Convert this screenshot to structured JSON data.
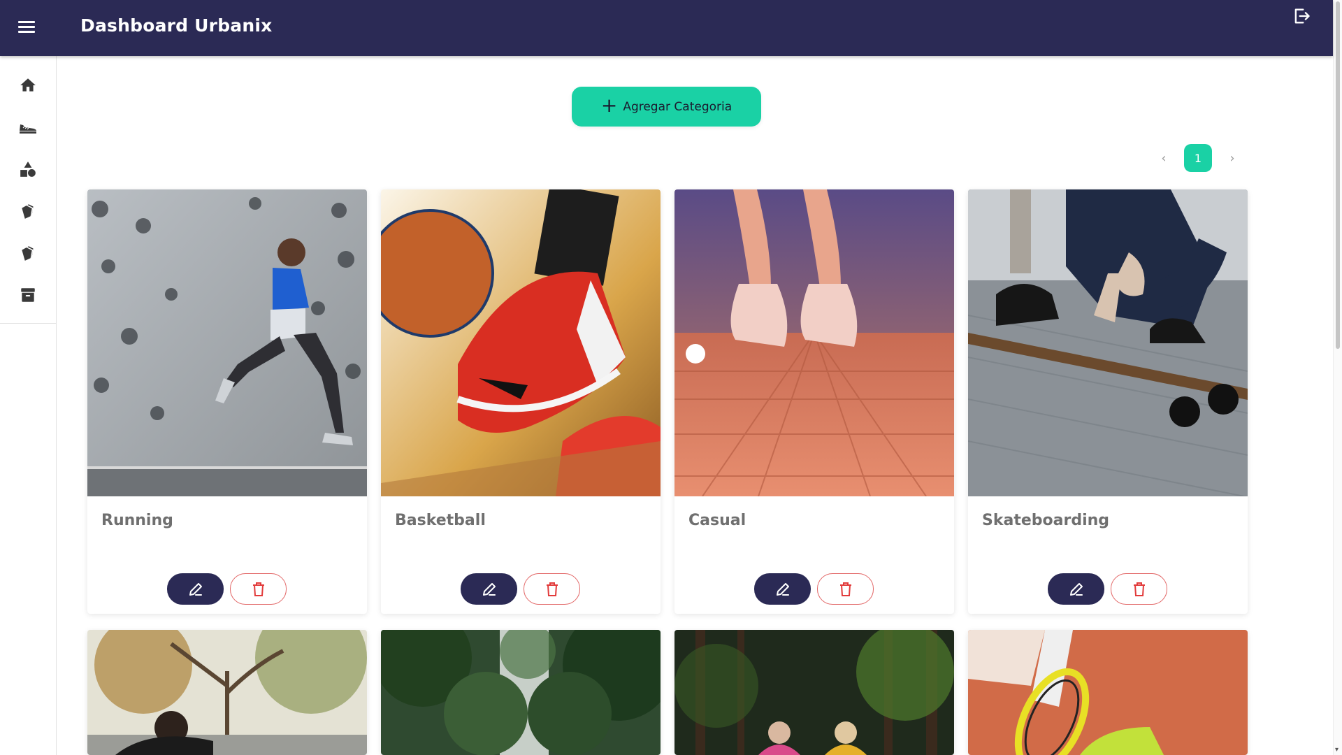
{
  "header": {
    "title": "Dashboard Urbanix",
    "menu_icon": "hamburger-menu-icon",
    "logout_icon": "logout-icon"
  },
  "sidebar": {
    "items": [
      {
        "icon": "home-icon"
      },
      {
        "icon": "sneaker-icon"
      },
      {
        "icon": "shapes-icon"
      },
      {
        "icon": "tags-icon"
      },
      {
        "icon": "tags-icon"
      },
      {
        "icon": "archive-box-icon"
      }
    ]
  },
  "toolbar": {
    "add_label": "Agregar Categoria"
  },
  "pagination": {
    "current": "1",
    "prev": "‹",
    "next": "›"
  },
  "cards": [
    {
      "name": "Running"
    },
    {
      "name": "Basketball"
    },
    {
      "name": "Casual"
    },
    {
      "name": "Skateboarding"
    },
    {
      "name": ""
    },
    {
      "name": ""
    },
    {
      "name": ""
    },
    {
      "name": ""
    }
  ],
  "colors": {
    "primary": "#2b2a55",
    "accent": "#1ad1a5",
    "danger": "#e26666"
  }
}
